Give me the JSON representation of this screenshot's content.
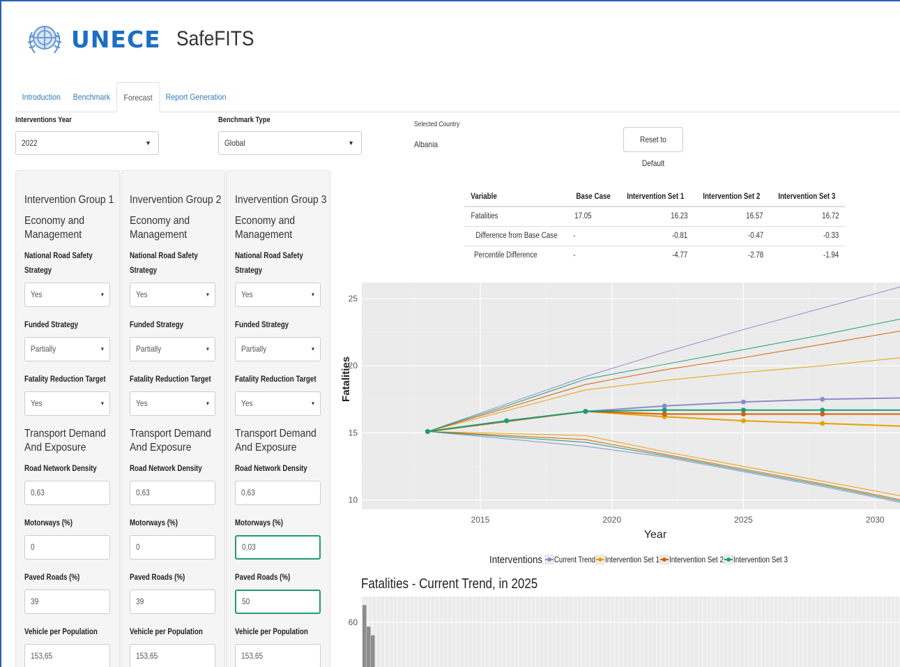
{
  "header": {
    "brand": "UNECE",
    "title": "SafeFITS"
  },
  "tabs": [
    {
      "label": "Introduction",
      "active": false
    },
    {
      "label": "Benchmark",
      "active": false
    },
    {
      "label": "Forecast",
      "active": true
    },
    {
      "label": "Report Generation",
      "active": false
    }
  ],
  "controls": {
    "interventions_year": {
      "label": "Interventions Year",
      "value": "2022"
    },
    "benchmark_type": {
      "label": "Benchmark Type",
      "value": "Global"
    },
    "selected_country": {
      "label": "Selected Country",
      "value": "Albania"
    },
    "reset_button": "Reset to Default"
  },
  "groups": [
    {
      "title": "Intervention Group 1",
      "section1": "Economy and Management",
      "nrss_label": "National Road Safety Strategy",
      "nrss": "Yes",
      "funded_label": "Funded Strategy",
      "funded": "Partially",
      "frt_label": "Fatality Reduction Target",
      "frt": "Yes",
      "section2": "Transport Demand And Exposure",
      "rnd_label": "Road Network Density",
      "rnd": "0,63",
      "mw_label": "Motorways (%)",
      "mw": "0",
      "paved_label": "Paved Roads (%)",
      "paved": "39",
      "vpp_label": "Vehicle per Population",
      "vpp": "153,65"
    },
    {
      "title": "Invervention Group 2",
      "section1": "Economy and Management",
      "nrss_label": "National Road Safety Strategy",
      "nrss": "Yes",
      "funded_label": "Funded Strategy",
      "funded": "Partially",
      "frt_label": "Fatality Reduction Target",
      "frt": "Yes",
      "section2": "Transport Demand And Exposure",
      "rnd_label": "Road Network Density",
      "rnd": "0,63",
      "mw_label": "Motorways (%)",
      "mw": "0",
      "paved_label": "Paved Roads (%)",
      "paved": "39",
      "vpp_label": "Vehicle per Population",
      "vpp": "153,65"
    },
    {
      "title": "Invervention Group 3",
      "section1": "Economy and Management",
      "nrss_label": "National Road Safety Strategy",
      "nrss": "Yes",
      "funded_label": "Funded Strategy",
      "funded": "Partially",
      "frt_label": "Fatality Reduction Target",
      "frt": "Yes",
      "section2": "Transport Demand And Exposure",
      "rnd_label": "Road Network Density",
      "rnd": "0,63",
      "mw_label": "Motorways (%)",
      "mw": "0,03",
      "paved_label": "Paved Roads (%)",
      "paved": "50",
      "vpp_label": "Vehicle per Population",
      "vpp": "153,65"
    }
  ],
  "results_table": {
    "headers": [
      "Variable",
      "Base Case",
      "Intervention Set 1",
      "Intervention Set 2",
      "Intervention Set 3"
    ],
    "rows": [
      [
        "Fatalities",
        "17.05",
        "16.23",
        "16.57",
        "16.72"
      ],
      [
        "Difference from Base Case",
        "-",
        "-0.81",
        "-0.47",
        "-0.33"
      ],
      [
        "Percentile Difference",
        "-",
        "-4.77",
        "-2.78",
        "-1.94"
      ]
    ]
  },
  "colors": {
    "current_trend": "#8c8ccc",
    "set1": "#e6a100",
    "set2": "#d95f02",
    "set3": "#1b9e77",
    "panel_bg": "#ebebeb",
    "accent": "#1d6fc4"
  },
  "chart_data": [
    {
      "type": "line",
      "xlabel": "Year",
      "ylabel": "Fatalities",
      "xlim": [
        2010.5,
        2031
      ],
      "ylim": [
        9.3,
        26.2
      ],
      "xticks": [
        2015,
        2020,
        2025,
        2030
      ],
      "yticks": [
        10,
        15,
        20,
        25
      ],
      "legend_title": "Interventions",
      "legend_position": "bottom",
      "series": [
        {
          "name": "Current Trend",
          "color_key": "current_trend",
          "x": [
            2013,
            2019,
            2022,
            2025,
            2028,
            2031
          ],
          "values": [
            15.1,
            16.6,
            17.0,
            17.3,
            17.5,
            17.6
          ],
          "upper": [
            15.1,
            19.2,
            21.0,
            22.7,
            24.3,
            25.9
          ],
          "lower": [
            15.1,
            14.0,
            13.2,
            12.1,
            11.0,
            9.8
          ]
        },
        {
          "name": "Intervention Set 1",
          "color_key": "set1",
          "x": [
            2013,
            2019,
            2022,
            2025,
            2028,
            2031
          ],
          "values": [
            15.1,
            16.6,
            16.2,
            15.9,
            15.7,
            15.5
          ],
          "upper": [
            15.1,
            18.2,
            18.9,
            19.5,
            20.0,
            20.6
          ],
          "lower": [
            15.1,
            14.8,
            13.6,
            12.5,
            11.4,
            10.3
          ]
        },
        {
          "name": "Intervention Set 2",
          "color_key": "set2",
          "x": [
            2013,
            2019,
            2022,
            2025,
            2028,
            2031
          ],
          "values": [
            15.1,
            16.6,
            16.4,
            16.4,
            16.4,
            16.4
          ],
          "upper": [
            15.1,
            18.6,
            19.7,
            20.6,
            21.6,
            22.6
          ],
          "lower": [
            15.1,
            14.5,
            13.4,
            12.3,
            11.2,
            10.0
          ]
        },
        {
          "name": "Intervention Set 3",
          "color_key": "set3",
          "x": [
            2013,
            2016,
            2019,
            2022,
            2025,
            2028,
            2031
          ],
          "values": [
            15.1,
            15.9,
            16.6,
            16.7,
            16.7,
            16.7,
            16.7
          ],
          "upper": [
            15.1,
            17.0,
            19.0,
            20.1,
            21.2,
            22.3,
            23.5
          ],
          "lower": [
            15.1,
            14.7,
            14.3,
            13.3,
            12.2,
            11.1,
            9.9
          ]
        }
      ]
    },
    {
      "type": "bar",
      "title": "Fatalities - Current Trend, in 2025",
      "yticks": [
        60
      ],
      "values": [
        68,
        58,
        54
      ]
    }
  ]
}
